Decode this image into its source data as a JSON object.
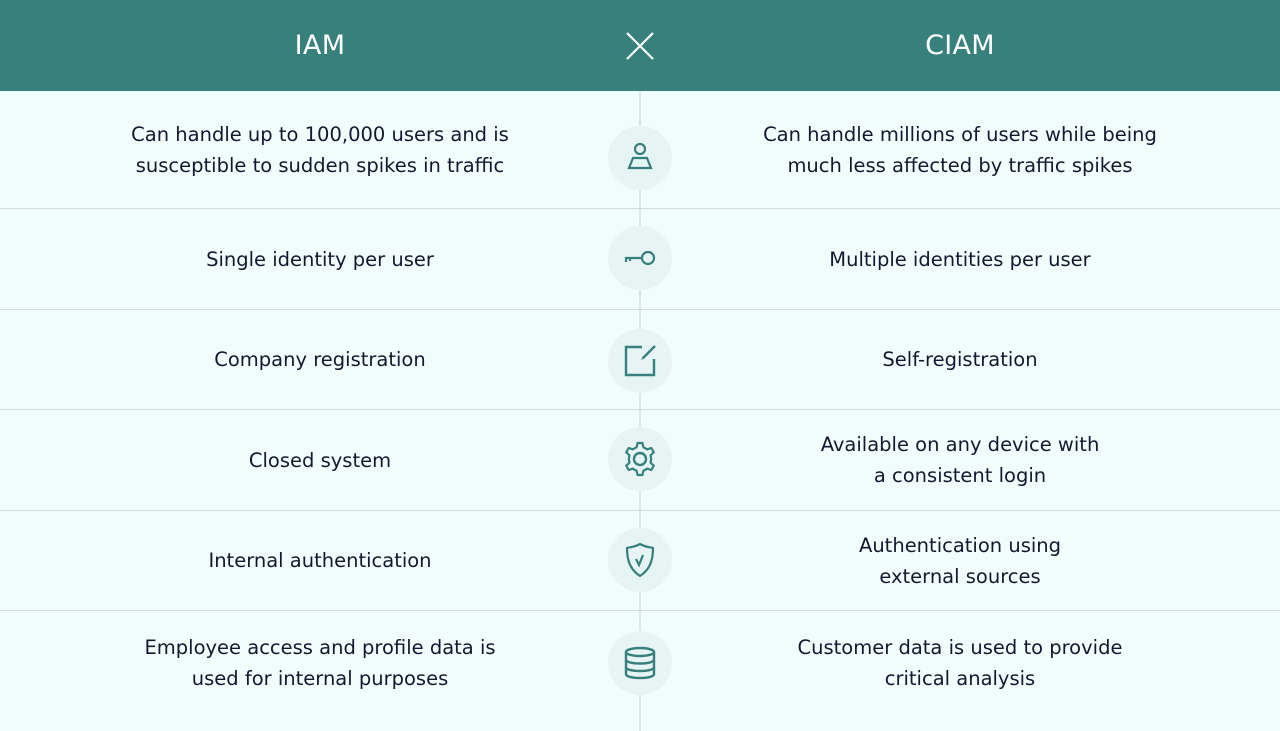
{
  "header": {
    "left_title": "IAM",
    "right_title": "CIAM",
    "versus_icon": "x-icon"
  },
  "colors": {
    "header_bg": "#38807C",
    "body_bg": "#F1FDFD",
    "icon_color": "#38807C",
    "badge_bg": "#E6F4F4",
    "text": "#14182E"
  },
  "rows": [
    {
      "icon": "user-icon",
      "iam": [
        "Can handle up to 100,000 users and is",
        "susceptible to sudden spikes in traffic"
      ],
      "ciam": [
        "Can handle millions of users while being",
        "much less affected by traffic spikes"
      ]
    },
    {
      "icon": "key-icon",
      "iam": [
        "Single identity per user"
      ],
      "ciam": [
        "Multiple identities per user"
      ]
    },
    {
      "icon": "edit-icon",
      "iam": [
        "Company registration"
      ],
      "ciam": [
        "Self-registration"
      ]
    },
    {
      "icon": "gear-icon",
      "iam": [
        "Closed system"
      ],
      "ciam": [
        "Available on any device with",
        "a consistent login"
      ]
    },
    {
      "icon": "shield-check-icon",
      "iam": [
        "Internal authentication"
      ],
      "ciam": [
        "Authentication using",
        "external sources"
      ]
    },
    {
      "icon": "database-icon",
      "iam": [
        "Employee access and profile data is",
        "used for internal purposes"
      ],
      "ciam": [
        "Customer data is used to provide",
        "critical analysis"
      ]
    }
  ]
}
